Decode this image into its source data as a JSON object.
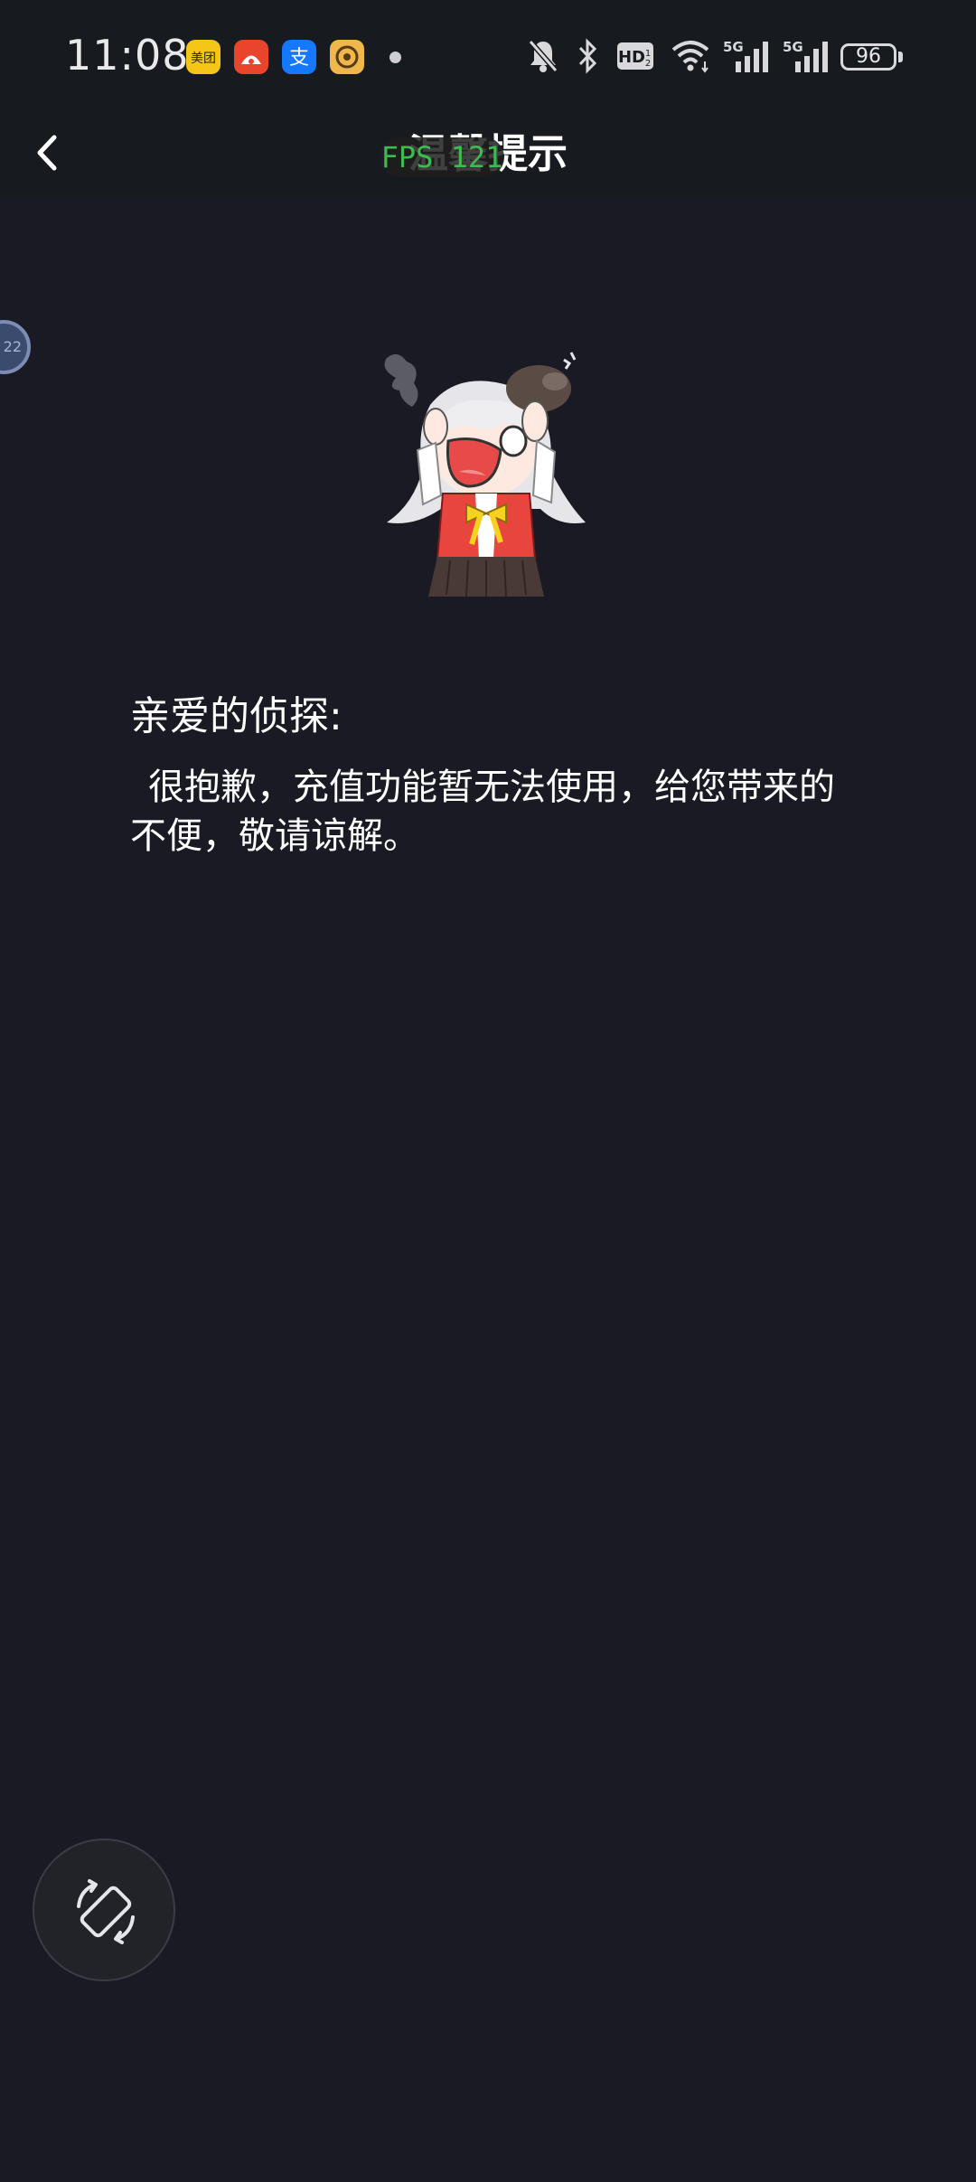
{
  "status_bar": {
    "time": "11:08",
    "notification_apps": [
      {
        "name": "meituan-icon",
        "label": "美团",
        "color": "#f5c518"
      },
      {
        "name": "app-red-icon",
        "color": "#e8452c"
      },
      {
        "name": "alipay-icon",
        "label": "支",
        "color": "#1677ff"
      },
      {
        "name": "app-target-icon",
        "color": "#f0b84a"
      }
    ],
    "network_label_1": "5G",
    "network_label_2": "5G",
    "hd_label": "HD",
    "battery_level": "96"
  },
  "header": {
    "title": "温馨提示",
    "fps_overlay": "FPS 121"
  },
  "edge_bubble": {
    "label": "22"
  },
  "content": {
    "greeting": "亲爱的侦探:",
    "message": "很抱歉，充值功能暂无法使用，给您带来的不便，敬请谅解。"
  }
}
